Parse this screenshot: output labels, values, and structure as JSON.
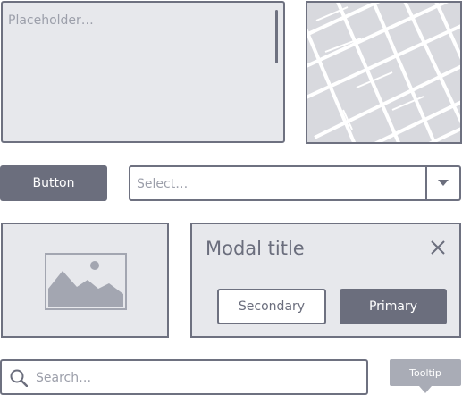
{
  "textarea": {
    "placeholder": "Placeholder…"
  },
  "map": {
    "icon": "map-icon"
  },
  "button": {
    "label": "Button"
  },
  "select": {
    "placeholder": "Select…",
    "icon": "caret-down-icon"
  },
  "image": {
    "icon": "image-icon"
  },
  "modal": {
    "title": "Modal title",
    "close_icon": "close-icon",
    "secondary_label": "Secondary",
    "primary_label": "Primary"
  },
  "search": {
    "placeholder": "Search…",
    "icon": "search-icon"
  },
  "tooltip": {
    "label": "Tooltip"
  },
  "colors": {
    "primary": "#6b6e7d",
    "surface": "#e7e8ec",
    "border": "#6e7180",
    "placeholder_text": "#9c9faa",
    "tooltip_bg": "#a9acb6"
  }
}
